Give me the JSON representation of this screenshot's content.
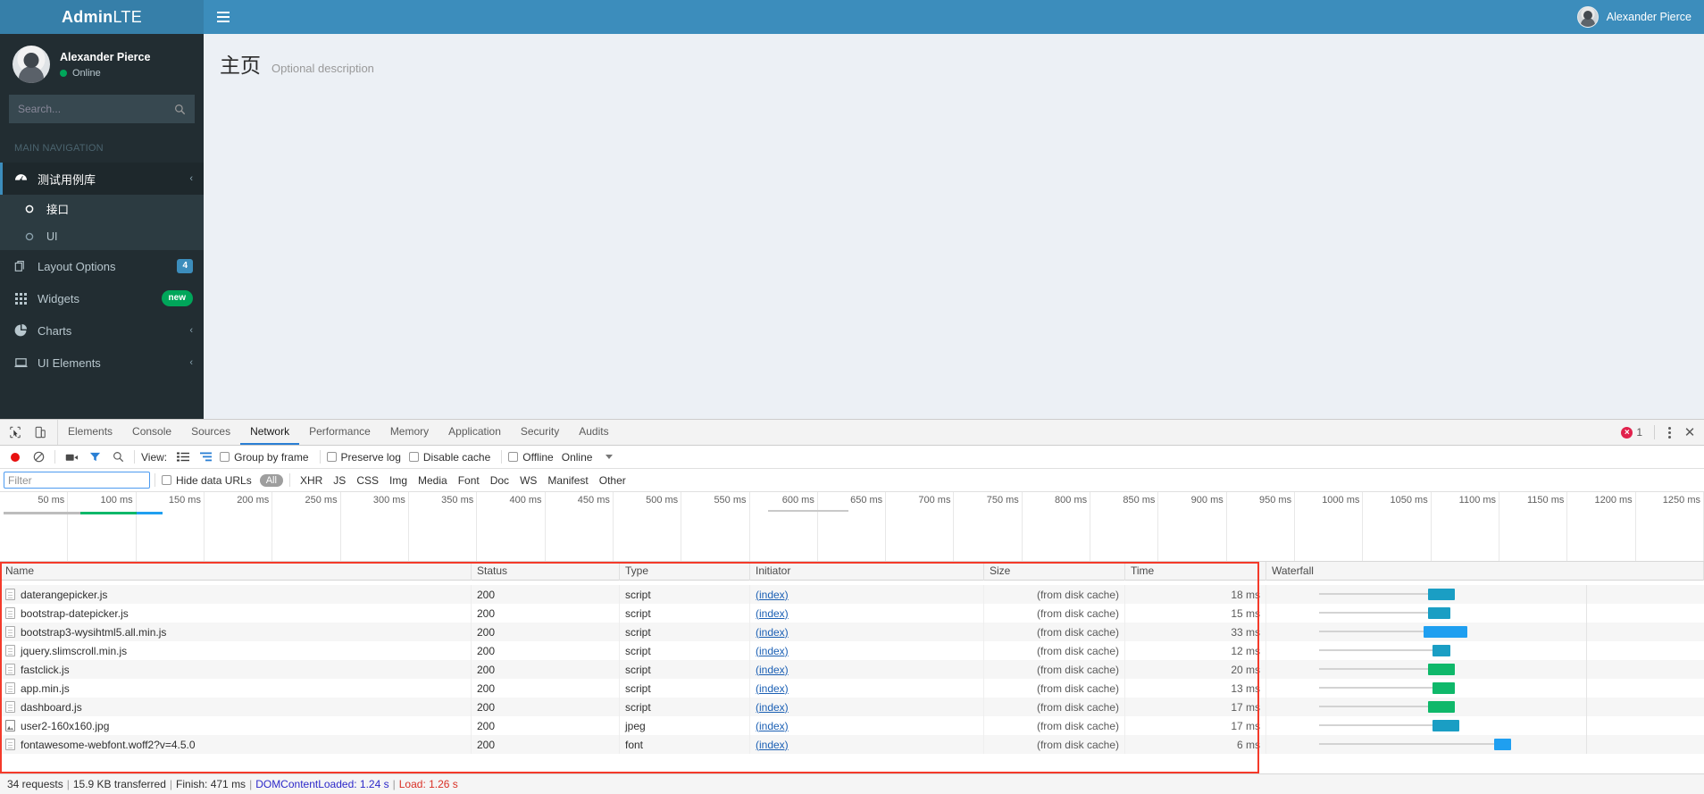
{
  "app": {
    "logo": {
      "bold": "Admin",
      "light": "LTE"
    },
    "menu_toggle": "hamburger-icon",
    "nav_user": "Alexander Pierce"
  },
  "sidebar": {
    "user": {
      "name": "Alexander Pierce",
      "status": "Online"
    },
    "search": {
      "placeholder": "Search...",
      "value": "",
      "icon": "search-icon"
    },
    "nav_header": "MAIN NAVIGATION",
    "items": [
      {
        "label": "测试用例库",
        "icon": "dashboard-icon",
        "angle": "‹",
        "active": true
      },
      {
        "label": "接口",
        "icon": "circle-o-icon",
        "sub": true,
        "on": true
      },
      {
        "label": "UI",
        "icon": "circle-o-icon",
        "sub": true,
        "on": false
      },
      {
        "label": "Layout Options",
        "icon": "files-icon",
        "badge": "4",
        "badge_color": "blue"
      },
      {
        "label": "Widgets",
        "icon": "grid-icon",
        "badge": "new",
        "badge_color": "green"
      },
      {
        "label": "Charts",
        "icon": "pie-chart-icon",
        "angle": "‹"
      },
      {
        "label": "UI Elements",
        "icon": "laptop-icon",
        "angle": "‹"
      }
    ]
  },
  "content": {
    "title": "主页",
    "description": "Optional description"
  },
  "devtools": {
    "tabs": [
      {
        "label": "Elements",
        "selected": false
      },
      {
        "label": "Console",
        "selected": false
      },
      {
        "label": "Sources",
        "selected": false
      },
      {
        "label": "Network",
        "selected": true
      },
      {
        "label": "Performance",
        "selected": false
      },
      {
        "label": "Memory",
        "selected": false
      },
      {
        "label": "Application",
        "selected": false
      },
      {
        "label": "Security",
        "selected": false
      },
      {
        "label": "Audits",
        "selected": false
      }
    ],
    "left_icons": [
      "inspect-icon",
      "device-toolbar-icon"
    ],
    "error_count": "1",
    "more_icon": "kebab-menu-icon",
    "close_icon": "close-icon",
    "toolbar": {
      "record_icon": "record-icon",
      "clear_icon": "clear-icon",
      "capture_screenshots_icon": "camera-icon",
      "filter_icon": "filter-icon",
      "search_icon": "search-icon",
      "view_label": "View:",
      "view_list_icon": "list-view-icon",
      "view_waterfall_icon": "waterfall-view-icon",
      "group_by_frame": "Group by frame",
      "preserve_log": "Preserve log",
      "disable_cache": "Disable cache",
      "offline": "Offline",
      "throttling": "Online"
    },
    "filterbar": {
      "filter_placeholder": "Filter",
      "filter_value": "",
      "hide_data_urls": "Hide data URLs",
      "types": [
        "All",
        "XHR",
        "JS",
        "CSS",
        "Img",
        "Media",
        "Font",
        "Doc",
        "WS",
        "Manifest",
        "Other"
      ],
      "selected_type": "All"
    },
    "timeline_ticks": [
      "50 ms",
      "100 ms",
      "150 ms",
      "200 ms",
      "250 ms",
      "300 ms",
      "350 ms",
      "400 ms",
      "450 ms",
      "500 ms",
      "550 ms",
      "600 ms",
      "650 ms",
      "700 ms",
      "750 ms",
      "800 ms",
      "850 ms",
      "900 ms",
      "950 ms",
      "1000 ms",
      "1050 ms",
      "1100 ms",
      "1150 ms",
      "1200 ms",
      "1250 ms"
    ],
    "columns": [
      "Name",
      "Status",
      "Type",
      "Initiator",
      "Size",
      "Time",
      "Waterfall"
    ],
    "rows": [
      {
        "name": "daterangepicker.js",
        "status": "200",
        "type": "script",
        "initiator": "(index)",
        "size": "(from disk cache)",
        "time": "18 ms",
        "icon": "js-file-icon",
        "wf_start": 37,
        "wf_w": 6,
        "wf_color": "#1a9ec4"
      },
      {
        "name": "bootstrap-datepicker.js",
        "status": "200",
        "type": "script",
        "initiator": "(index)",
        "size": "(from disk cache)",
        "time": "15 ms",
        "icon": "js-file-icon",
        "wf_start": 37,
        "wf_w": 5,
        "wf_color": "#1a9ec4"
      },
      {
        "name": "bootstrap3-wysihtml5.all.min.js",
        "status": "200",
        "type": "script",
        "initiator": "(index)",
        "size": "(from disk cache)",
        "time": "33 ms",
        "icon": "js-file-icon",
        "wf_start": 36,
        "wf_w": 10,
        "wf_color": "#1f9ff0"
      },
      {
        "name": "jquery.slimscroll.min.js",
        "status": "200",
        "type": "script",
        "initiator": "(index)",
        "size": "(from disk cache)",
        "time": "12 ms",
        "icon": "js-file-icon",
        "wf_start": 38,
        "wf_w": 4,
        "wf_color": "#1a9ec4"
      },
      {
        "name": "fastclick.js",
        "status": "200",
        "type": "script",
        "initiator": "(index)",
        "size": "(from disk cache)",
        "time": "20 ms",
        "icon": "js-file-icon",
        "wf_start": 37,
        "wf_w": 6,
        "wf_color": "#0fb86a"
      },
      {
        "name": "app.min.js",
        "status": "200",
        "type": "script",
        "initiator": "(index)",
        "size": "(from disk cache)",
        "time": "13 ms",
        "icon": "js-file-icon",
        "wf_start": 38,
        "wf_w": 5,
        "wf_color": "#0fb86a"
      },
      {
        "name": "dashboard.js",
        "status": "200",
        "type": "script",
        "initiator": "(index)",
        "size": "(from disk cache)",
        "time": "17 ms",
        "icon": "js-file-icon",
        "wf_start": 37,
        "wf_w": 6,
        "wf_color": "#0fb86a"
      },
      {
        "name": "user2-160x160.jpg",
        "status": "200",
        "type": "jpeg",
        "initiator": "(index)",
        "size": "(from disk cache)",
        "time": "17 ms",
        "icon": "image-file-icon",
        "wf_start": 38,
        "wf_w": 6,
        "wf_color": "#1a9ec4"
      },
      {
        "name": "fontawesome-webfont.woff2?v=4.5.0",
        "status": "200",
        "type": "font",
        "initiator": "(index)",
        "size": "(from disk cache)",
        "time": "6 ms",
        "icon": "font-file-icon",
        "wf_start": 52,
        "wf_w": 4,
        "wf_color": "#1f9ff0"
      }
    ],
    "status_bar": {
      "requests": "34 requests",
      "transferred": "15.9 KB transferred",
      "finish": "Finish: 471 ms",
      "dom_content_loaded": "DOMContentLoaded: 1.24 s",
      "load": "Load: 1.26 s"
    }
  },
  "colors": {
    "brand": "#3c8dbc",
    "sidebar": "#222d32",
    "accent_green": "#00a65a",
    "highlight_red": "#f43a2a",
    "tab_active": "#2a7fd4"
  }
}
